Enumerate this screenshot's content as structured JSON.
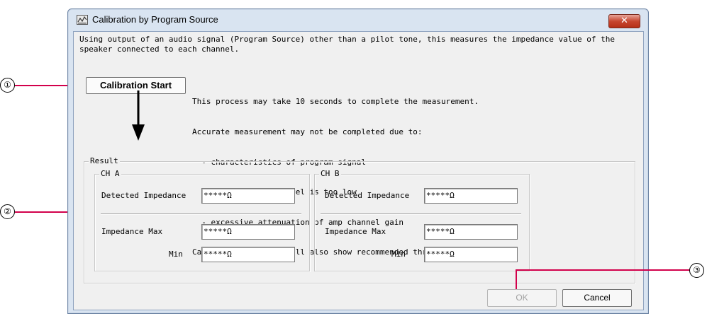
{
  "window": {
    "title": "Calibration by Program Source",
    "close_label": "✕"
  },
  "description": {
    "line1": "Using output of an audio signal (Program Source) other than a pilot tone, this measures the impedance value of the",
    "line2": "speaker connected to each channel."
  },
  "calibration_button": "Calibration Start",
  "notes": [
    "This process may take 10 seconds to complete the measurement.",
    "Accurate measurement may not be completed due to:",
    "  - characteristics of program signal",
    "  - program signal level is too low",
    "  - excessive attenuation of amp channel gain",
    "Calibration results will also show recommended threshold values."
  ],
  "result": {
    "label": "Result",
    "channels": [
      {
        "label": "CH A",
        "detected_label": "Detected Impedance",
        "detected_value": "*****Ω",
        "max_label": "Impedance Max",
        "max_value": "*****Ω",
        "min_label": "Min",
        "min_value": "*****Ω"
      },
      {
        "label": "CH B",
        "detected_label": "Detected Impedance",
        "detected_value": "*****Ω",
        "max_label": "Impedance Max",
        "max_value": "*****Ω",
        "min_label": "Min",
        "min_value": "*****Ω"
      }
    ]
  },
  "buttons": {
    "ok": "OK",
    "cancel": "Cancel"
  },
  "callouts": [
    "①",
    "②",
    "③"
  ],
  "colors": {
    "callout_line": "#d2004b"
  }
}
